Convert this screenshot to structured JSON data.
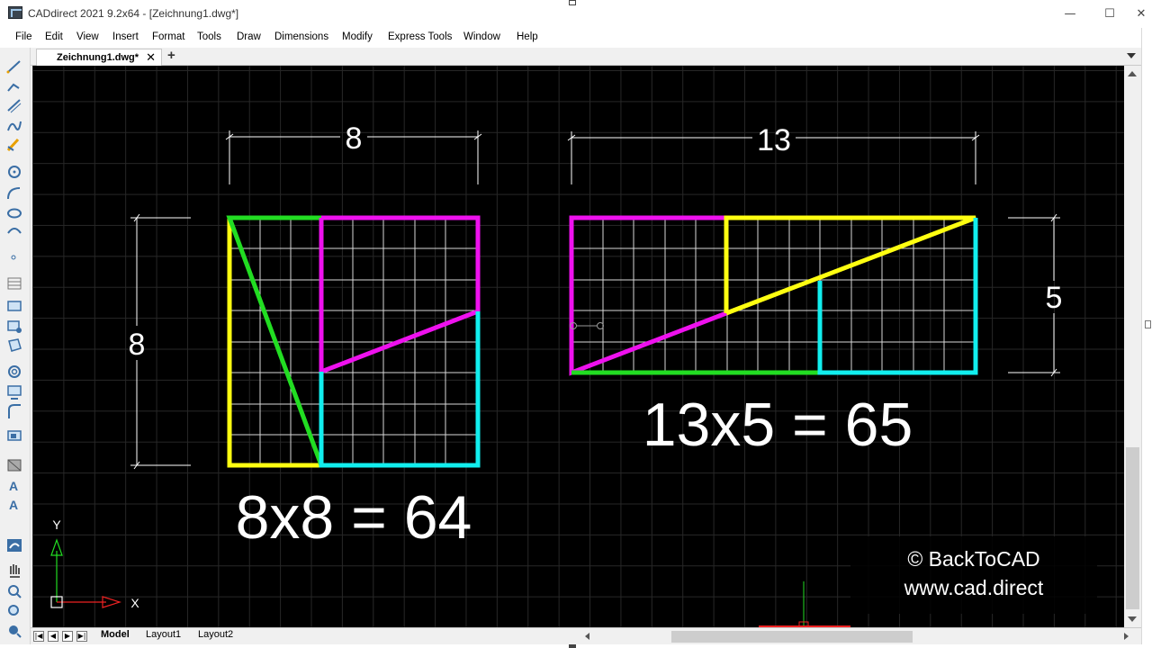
{
  "window": {
    "title": "CADdirect 2021 9.2x64  - [Zeichnung1.dwg*]",
    "minimize_glyph": "—",
    "maximize_glyph": "☐",
    "close_glyph": "✕"
  },
  "menu": [
    "File",
    "Edit",
    "View",
    "Insert",
    "Format",
    "Tools",
    "Draw",
    "Dimensions",
    "Modify",
    "Express Tools",
    "Window",
    "Help"
  ],
  "tabs": {
    "active": "Zeichnung1.dwg*",
    "close_glyph": "✕",
    "new_glyph": "+"
  },
  "drawing": {
    "left": {
      "dim_top": "8",
      "dim_left": "8",
      "caption": "8x8 = 64"
    },
    "right": {
      "dim_top": "13",
      "dim_right": "5",
      "caption": "13x5 = 65"
    },
    "ucs": {
      "x_label": "X",
      "y_label": "Y"
    },
    "colors": {
      "green": "#22dd22",
      "magenta": "#ee11ee",
      "yellow": "#ffff11",
      "cyan": "#11eeee",
      "white": "#ffffff"
    }
  },
  "watermark": {
    "line1": "© BackToCAD",
    "line2": "www.cad.direct"
  },
  "layout_tabs": {
    "model": "Model",
    "layout1": "Layout1",
    "layout2": "Layout2"
  },
  "nav_buttons": [
    "|◀",
    "◀",
    "▶",
    "▶|"
  ]
}
